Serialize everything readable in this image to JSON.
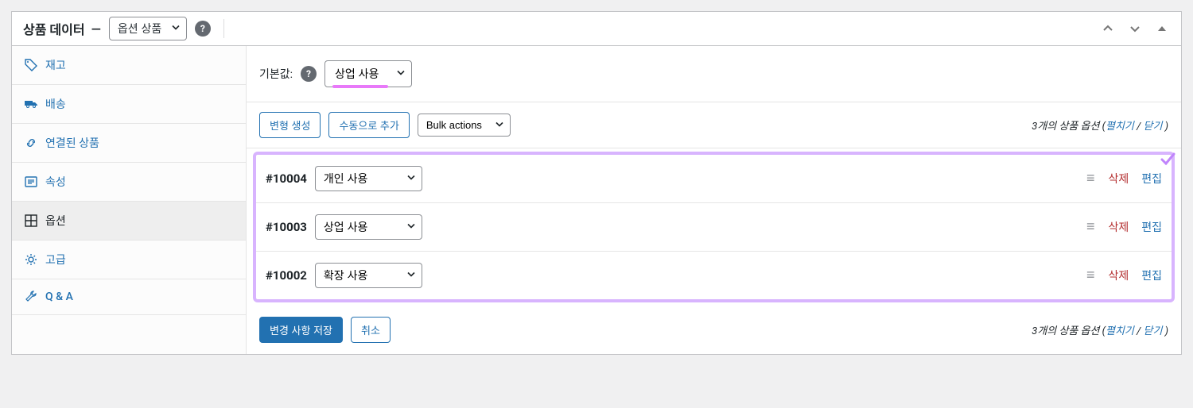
{
  "header": {
    "title": "상품 데이터",
    "dash": "—",
    "product_type": "옵션 상품"
  },
  "tabs": {
    "items": [
      {
        "slug": "inventory",
        "label": "재고",
        "icon": "inventory"
      },
      {
        "slug": "shipping",
        "label": "배송",
        "icon": "truck"
      },
      {
        "slug": "linked",
        "label": "연결된 상품",
        "icon": "link"
      },
      {
        "slug": "attributes",
        "label": "속성",
        "icon": "list"
      },
      {
        "slug": "variations",
        "label": "옵션",
        "icon": "grid",
        "active": true
      },
      {
        "slug": "advanced",
        "label": "고급",
        "icon": "gear"
      },
      {
        "slug": "qa",
        "label": "Q & A",
        "icon": "wrench"
      }
    ]
  },
  "content": {
    "default_label": "기본값:",
    "default_value": "상업 사용",
    "generate_btn": "변형 생성",
    "add_manual_btn": "수동으로 추가",
    "bulk_actions": "Bulk actions",
    "count_template": {
      "prefix": "3개의 상품 옵션 (",
      "expand": "펼치기",
      "sep": " / ",
      "collapse": "닫기",
      "suffix": " )"
    },
    "variations": [
      {
        "id": "#10004",
        "value": "개인 사용"
      },
      {
        "id": "#10003",
        "value": "상업 사용"
      },
      {
        "id": "#10002",
        "value": "확장 사용"
      }
    ],
    "remove_label": "삭제",
    "edit_label": "편집",
    "save_btn": "변경 사항 저장",
    "cancel_btn": "취소"
  }
}
